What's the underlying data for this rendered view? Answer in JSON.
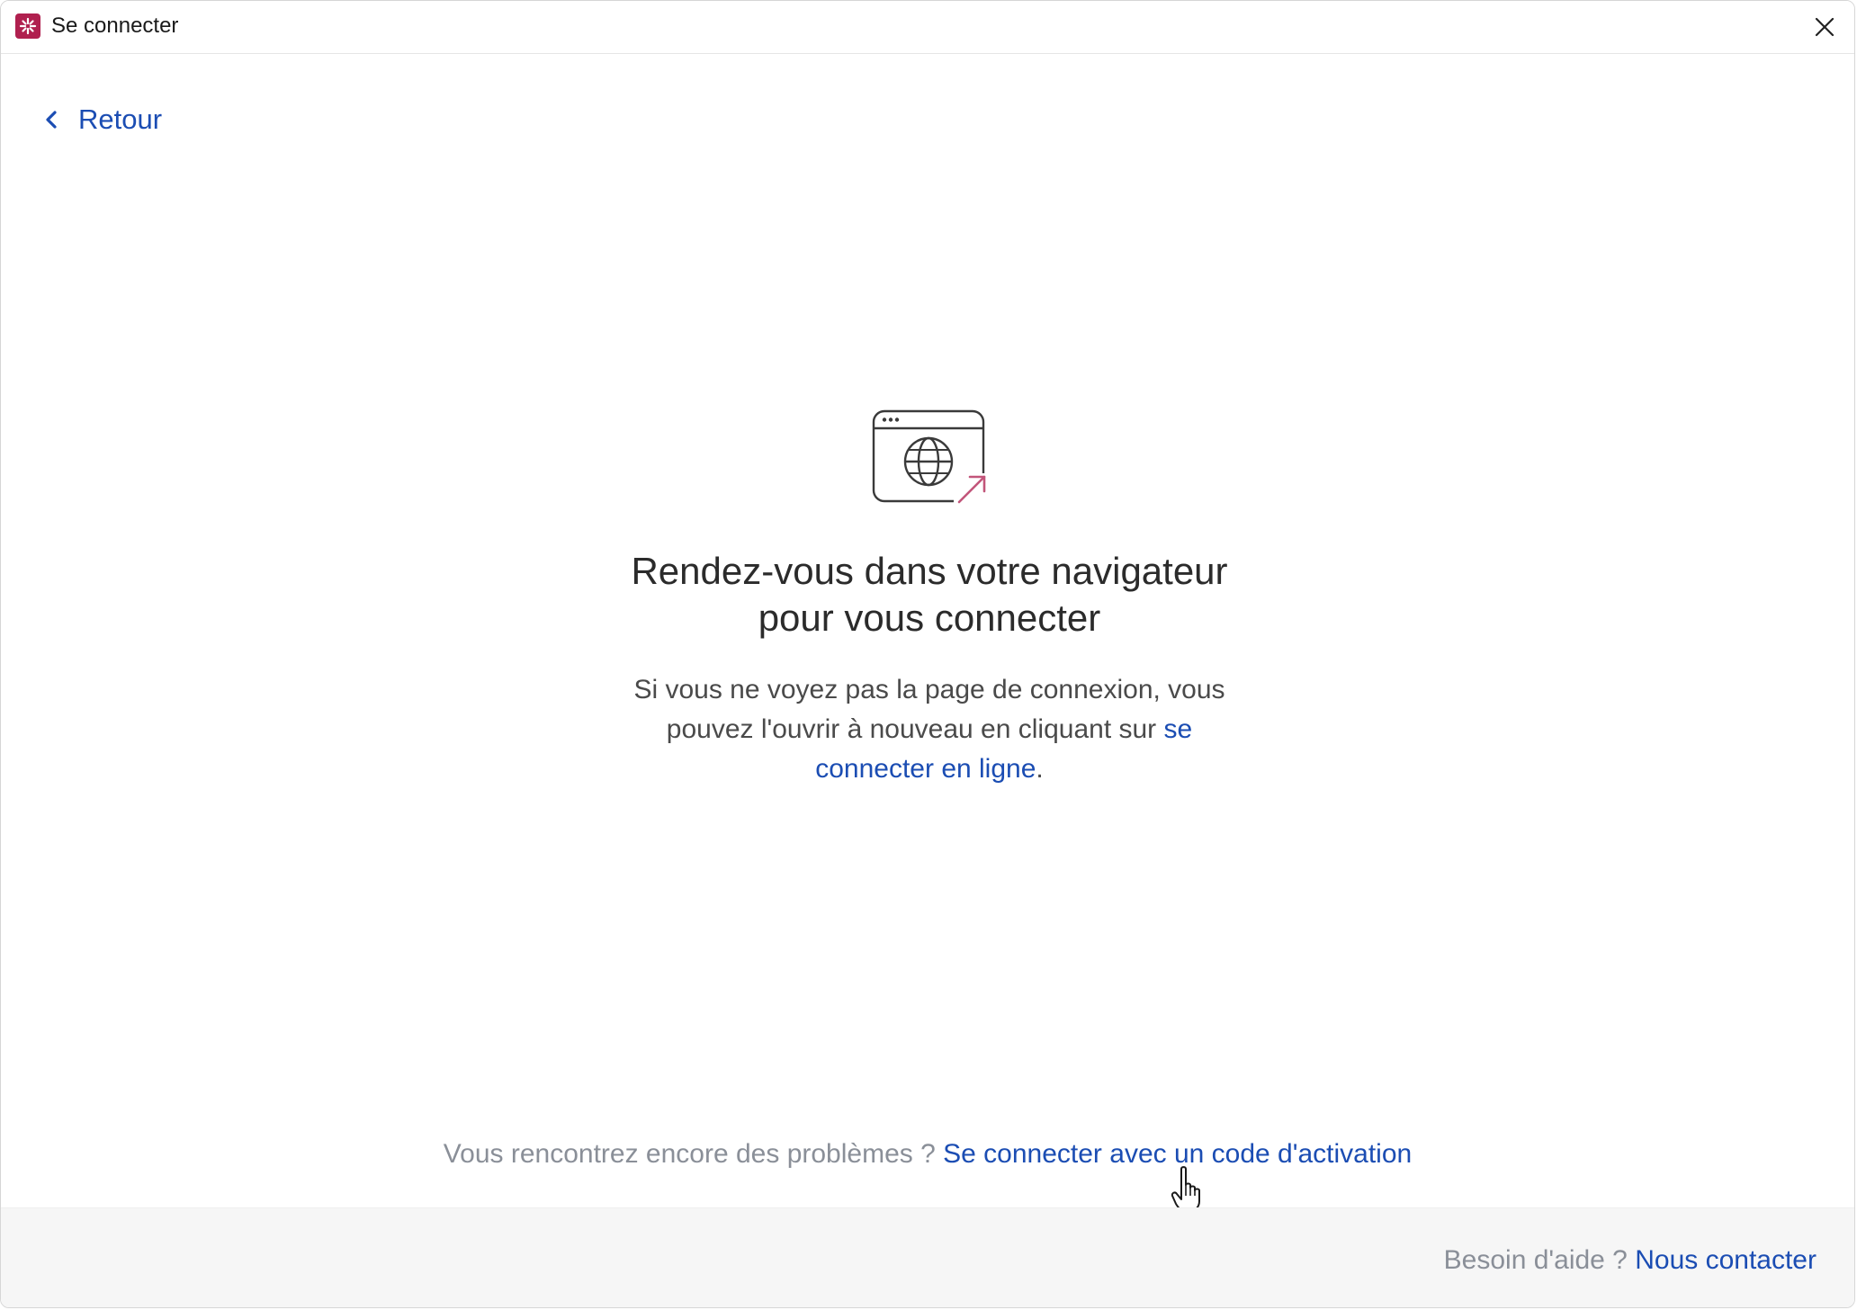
{
  "window": {
    "title": "Se connecter",
    "app_icon": "app-logo-icon",
    "close_icon": "close-icon",
    "brand_color": "#b0204f"
  },
  "nav": {
    "back_label": "Retour",
    "back_icon": "chevron-left-icon"
  },
  "main": {
    "illustration_icon": "browser-globe-icon",
    "headline_line1": "Rendez-vous dans votre navigateur",
    "headline_line2": "pour vous connecter",
    "desc_prefix": "Si vous ne voyez pas la page de connexion, vous pouvez l'ouvrir à nouveau en cliquant sur",
    "desc_link": "se connecter en ligne",
    "desc_suffix": "."
  },
  "problems": {
    "question": "Vous rencontrez encore des problèmes ?",
    "activation_link": "Se connecter avec un code d'activation"
  },
  "footer": {
    "help_text": "Besoin d'aide ?",
    "contact_link": "Nous contacter"
  },
  "colors": {
    "link": "#1b4db3",
    "muted": "#8a8f98",
    "accent_arrow": "#c2557a"
  }
}
